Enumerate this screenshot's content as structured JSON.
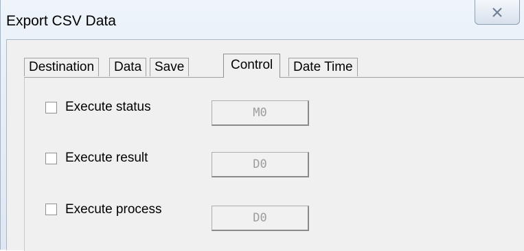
{
  "window": {
    "title": "Export CSV Data"
  },
  "tabs": [
    {
      "label": "Destination",
      "active": false
    },
    {
      "label": "Data",
      "active": false
    },
    {
      "label": "Save",
      "active": false
    },
    {
      "label": "Control",
      "active": true
    },
    {
      "label": "Date Time",
      "active": false
    }
  ],
  "control": {
    "rows": [
      {
        "label": "Execute status",
        "checked": false,
        "address": "M0"
      },
      {
        "label": "Execute result",
        "checked": false,
        "address": "D0"
      },
      {
        "label": "Execute process",
        "checked": false,
        "address": "D0"
      }
    ]
  },
  "icons": {
    "close": "close-x-icon"
  }
}
